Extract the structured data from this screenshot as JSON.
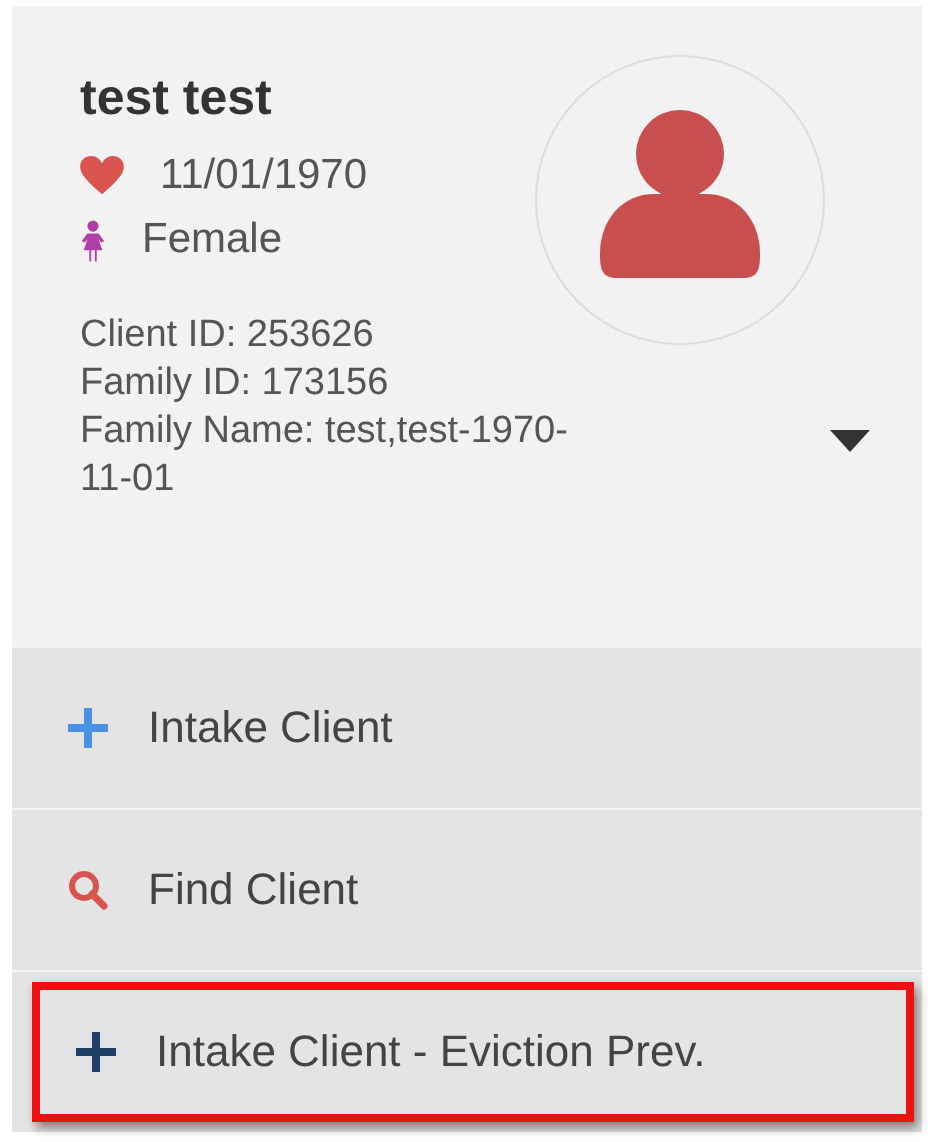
{
  "client": {
    "name": "test test",
    "birth_date": "11/01/1970",
    "gender": "Female",
    "details": [
      "Client ID: 253626",
      "Family ID: 173156",
      "Family Name: test,test-1970-11-01"
    ]
  },
  "menu": [
    {
      "kind": "plus",
      "color": "#4a90e2",
      "label": "Intake Client",
      "highlighted": false
    },
    {
      "kind": "search",
      "color": "#d9534f",
      "label": "Find Client",
      "highlighted": false
    },
    {
      "kind": "plus",
      "color": "#1f3f66",
      "label": "Intake Client - Eviction Prev.",
      "highlighted": true
    }
  ]
}
